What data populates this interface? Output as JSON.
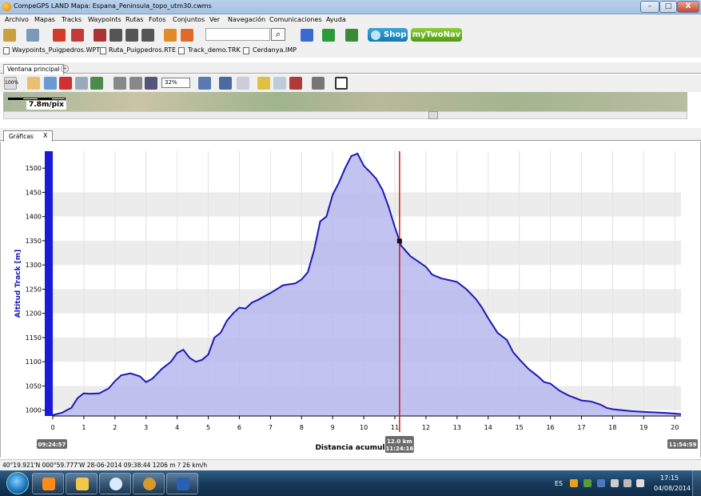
{
  "window": {
    "title": "CompeGPS LAND Mapa: Espana_Peninsula_topo_utm30.cwms",
    "min_label": "–",
    "max_label": "□",
    "close_label": "X"
  },
  "menu": [
    "Archivo",
    "Mapas",
    "Tracks",
    "Waypoints",
    "Rutas",
    "Fotos",
    "Conjuntos",
    "Ver",
    "Navegación",
    "Comunicaciones",
    "Ayuda"
  ],
  "toolbar1": {
    "search_value": "",
    "search_icon": "magnifier-icon",
    "shop_label": "Shop",
    "mytwonav_label": "myTwoNav"
  },
  "files": [
    "Waypoints_Puigpedros.WPT",
    "Ruta_Puigpedros.RTE",
    "Track_demo.TRK",
    "Cerdanya.IMP"
  ],
  "view_tabs": {
    "main": "Ventana principal",
    "add": "+"
  },
  "toolbar2": {
    "zoom_value": "32%",
    "zoom100_label": "100%"
  },
  "map": {
    "scale_label": "7.8m/pix"
  },
  "graph_tab": {
    "label": "Gráficas",
    "close": "X"
  },
  "chart_data": {
    "type": "area",
    "title": "",
    "ylabel": "Altitud Track [m]",
    "xlabel": "Distancia acumula",
    "xlim": [
      0,
      20.2
    ],
    "ylim": [
      988,
      1535
    ],
    "yticks": [
      1000,
      1050,
      1100,
      1150,
      1200,
      1250,
      1300,
      1350,
      1400,
      1450,
      1500
    ],
    "xticks": [
      0,
      1,
      2,
      3,
      4,
      5,
      6,
      7,
      8,
      9,
      10,
      11,
      12,
      13,
      14,
      15,
      16,
      17,
      18,
      19,
      20
    ],
    "grid": true,
    "colors": {
      "line": "#1a1ab5",
      "fill": "#b9b9f0",
      "cursor": "#e01010",
      "band": "#ececec"
    },
    "start_time": "09:24:57",
    "end_time": "11:54:59",
    "cursor": {
      "x": 11.15,
      "label_dist": "12.0 km",
      "label_time": "11:24:16"
    },
    "series": [
      {
        "x": [
          0,
          0.3,
          0.6,
          0.8,
          1.0,
          1.2,
          1.5,
          1.8,
          2.0,
          2.2,
          2.5,
          2.8,
          3.0,
          3.2,
          3.5,
          3.8,
          4.0,
          4.2,
          4.4,
          4.6,
          4.8,
          5.0,
          5.2,
          5.4,
          5.6,
          5.8,
          6.0,
          6.2,
          6.4,
          6.6,
          6.8,
          7.0,
          7.2,
          7.4,
          7.6,
          7.8,
          8.0,
          8.2,
          8.4,
          8.6,
          8.8,
          9.0,
          9.2,
          9.4,
          9.6,
          9.8,
          10.0,
          10.2,
          10.4,
          10.6,
          10.8,
          11.0,
          11.2,
          11.5,
          11.8,
          12.0,
          12.2,
          12.5,
          12.8,
          13.0,
          13.3,
          13.6,
          13.8,
          14.0,
          14.3,
          14.6,
          14.8,
          15.0,
          15.3,
          15.6,
          15.8,
          16.0,
          16.3,
          16.6,
          16.8,
          17.0,
          17.3,
          17.6,
          17.8,
          18.0,
          18.3,
          18.6,
          18.9,
          19.2,
          19.5,
          19.8,
          20.0,
          20.2
        ],
        "values": [
          990,
          995,
          1005,
          1025,
          1035,
          1034,
          1035,
          1045,
          1060,
          1072,
          1076,
          1070,
          1058,
          1065,
          1085,
          1100,
          1118,
          1125,
          1108,
          1100,
          1104,
          1115,
          1150,
          1160,
          1185,
          1200,
          1212,
          1210,
          1222,
          1228,
          1235,
          1242,
          1250,
          1258,
          1260,
          1262,
          1270,
          1285,
          1330,
          1390,
          1400,
          1445,
          1470,
          1500,
          1525,
          1530,
          1505,
          1492,
          1478,
          1455,
          1420,
          1378,
          1340,
          1318,
          1305,
          1296,
          1280,
          1272,
          1268,
          1265,
          1250,
          1230,
          1212,
          1190,
          1160,
          1145,
          1120,
          1105,
          1085,
          1070,
          1058,
          1055,
          1040,
          1030,
          1025,
          1020,
          1018,
          1012,
          1005,
          1002,
          1000,
          998,
          997,
          996,
          995,
          994,
          993,
          992
        ]
      }
    ]
  },
  "status": {
    "text": "40°19.921'N 000°59.777'W  28-06-2014  09:38:44  1206 m  ?  26 km/h"
  },
  "taskbar": {
    "lang": "ES",
    "time": "17:15",
    "date": "04/08/2014"
  }
}
